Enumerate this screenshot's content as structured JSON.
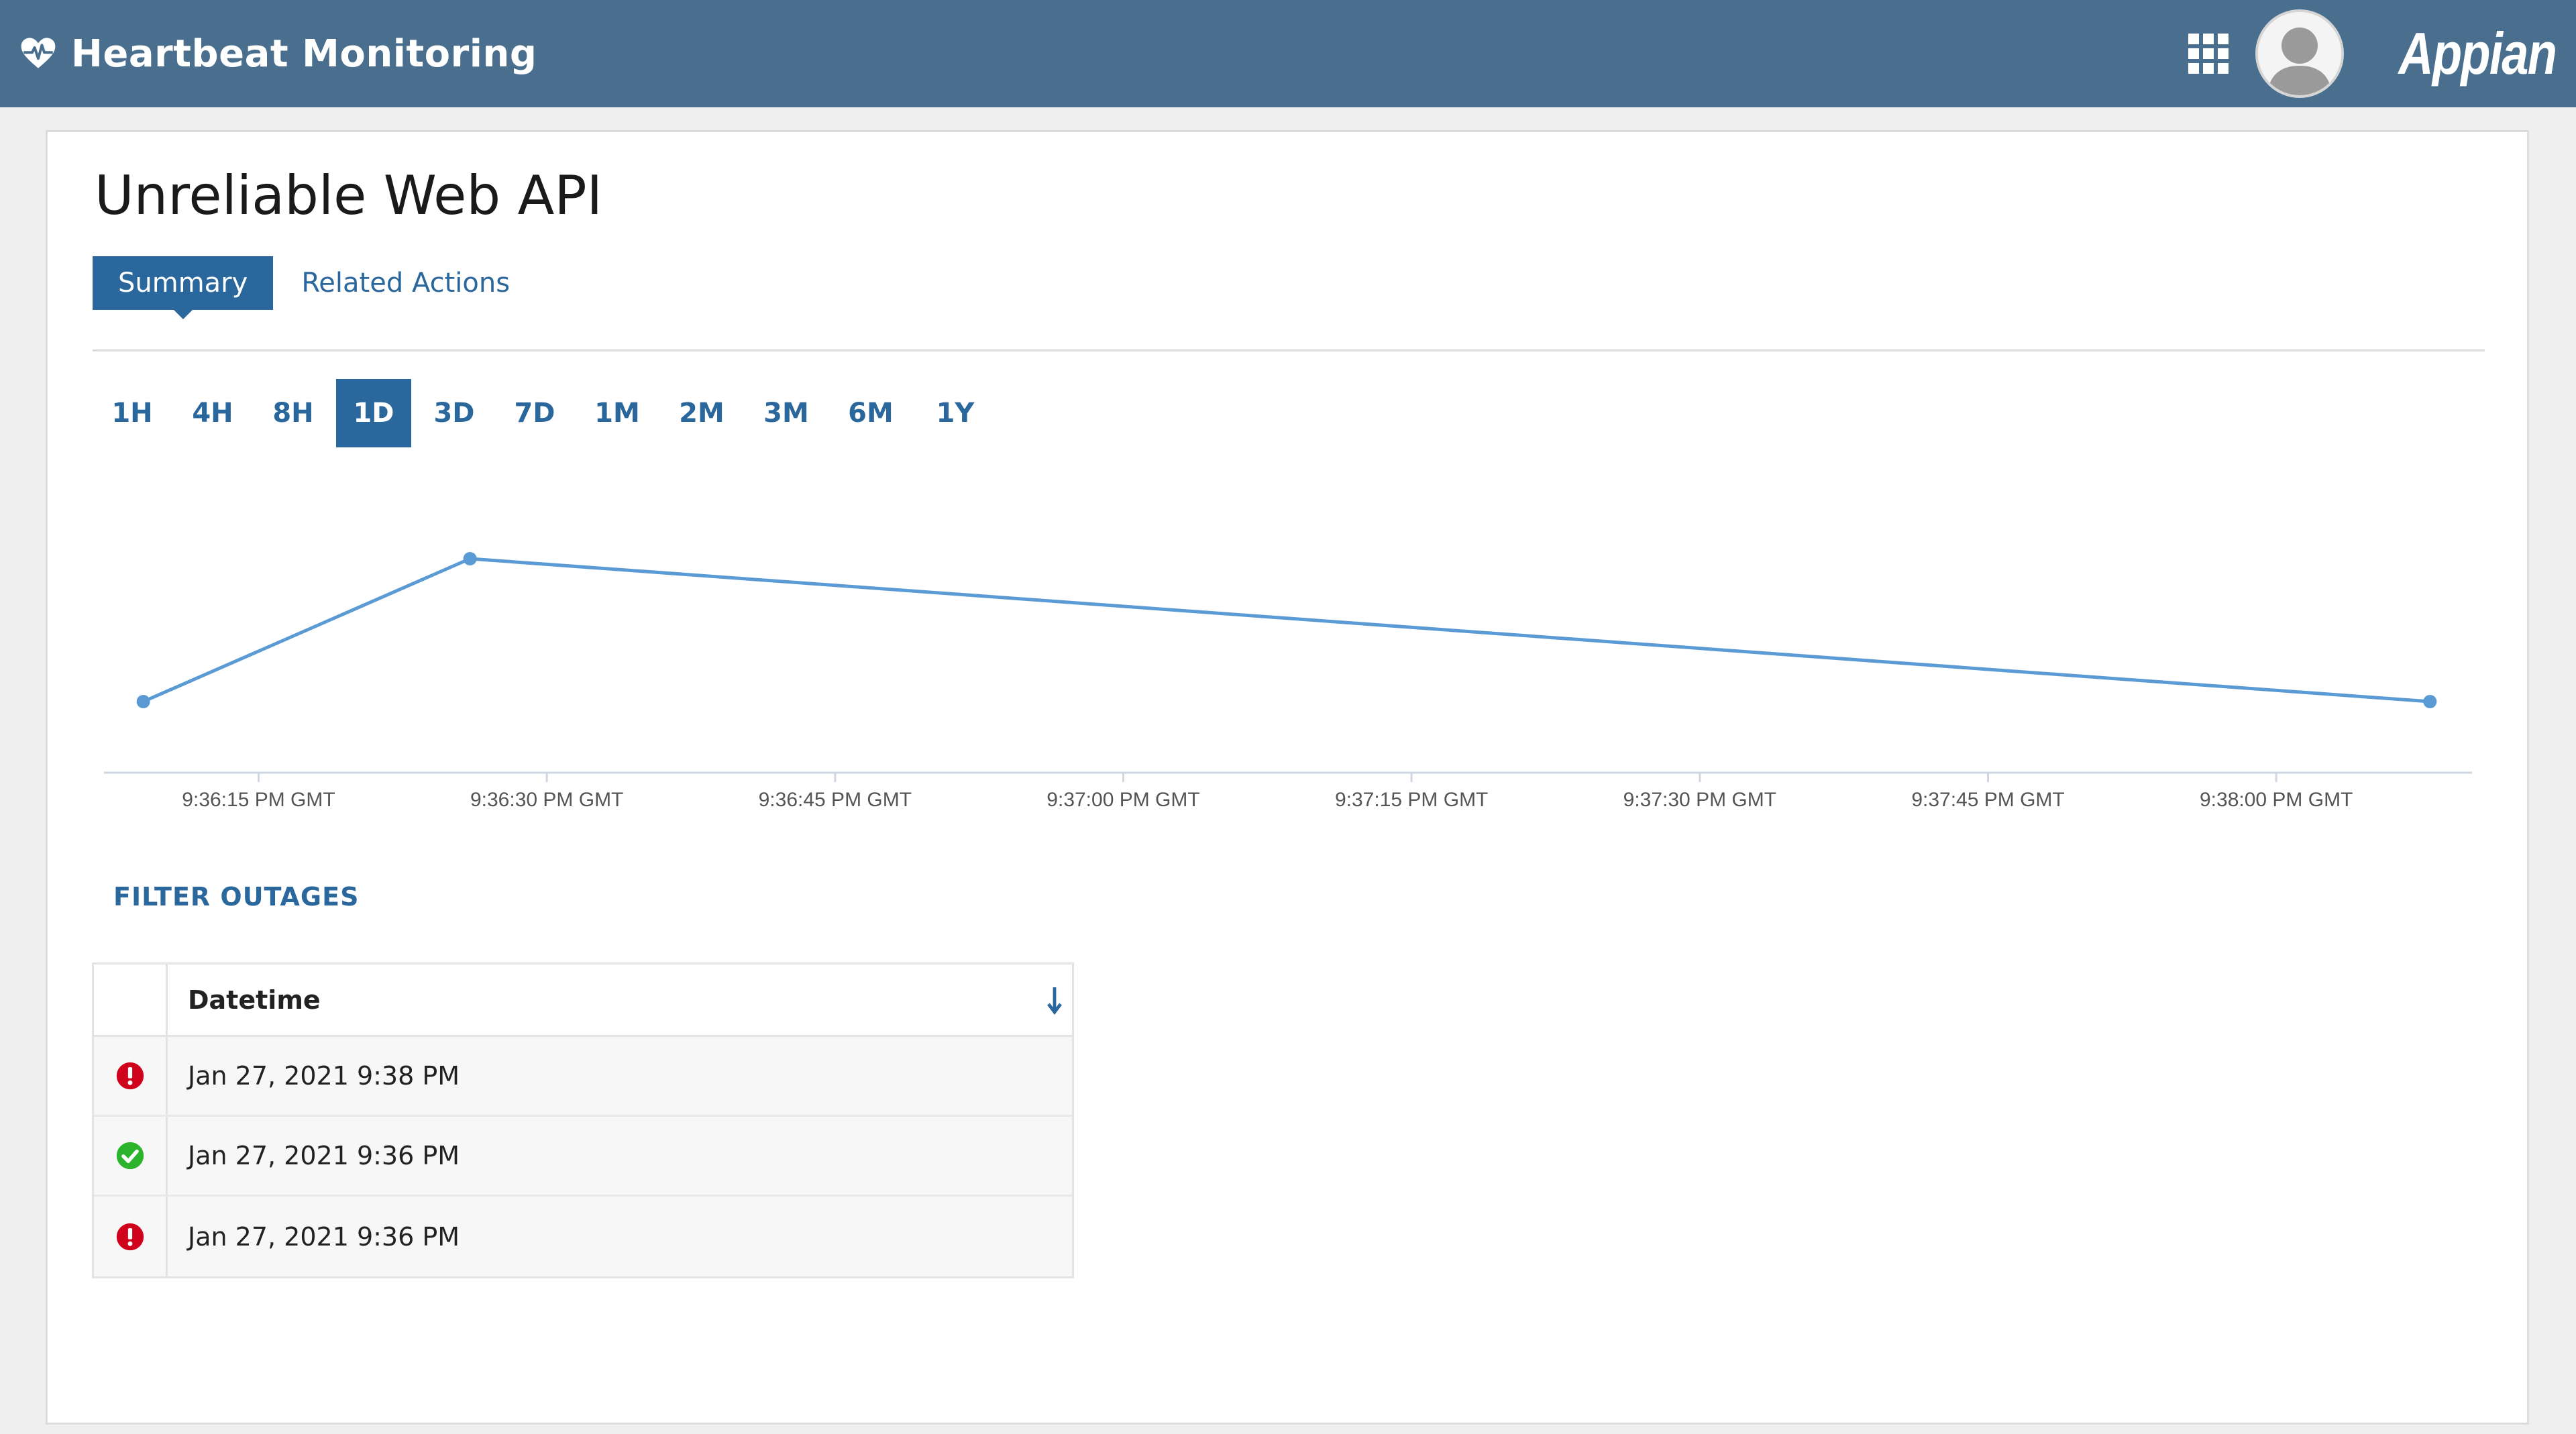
{
  "header": {
    "app_title": "Heartbeat Monitoring",
    "icons": {
      "app": "heart-pulse-icon",
      "launcher": "app-grid-icon",
      "avatar": "user-avatar"
    },
    "logo_text": "Appian",
    "bar_color": "#4a6f8e"
  },
  "record": {
    "title": "Unreliable Web API",
    "tabs": [
      {
        "label": "Summary",
        "active": true
      },
      {
        "label": "Related Actions",
        "active": false
      }
    ]
  },
  "ranges": {
    "options": [
      "1H",
      "4H",
      "8H",
      "1D",
      "3D",
      "7D",
      "1M",
      "2M",
      "3M",
      "6M",
      "1Y"
    ],
    "selected": "1D"
  },
  "chart_data": {
    "type": "line",
    "title": "",
    "xlabel": "",
    "ylabel": "",
    "x_ticks": [
      "9:36:15 PM GMT",
      "9:36:30 PM GMT",
      "9:36:45 PM GMT",
      "9:37:00 PM GMT",
      "9:37:15 PM GMT",
      "9:37:30 PM GMT",
      "9:37:45 PM GMT",
      "9:38:00 PM GMT"
    ],
    "series": [
      {
        "color": "#5b9bd5",
        "points": [
          {
            "x": "9:36:09 PM GMT",
            "y": 0
          },
          {
            "x": "9:36:26 PM GMT",
            "y": 1
          },
          {
            "x": "9:38:08 PM GMT",
            "y": 0
          }
        ]
      }
    ],
    "x_range": [
      "9:36:08 PM GMT",
      "9:38:09 PM GMT"
    ],
    "y_visible_axis": false,
    "grid": false
  },
  "outages": {
    "filter_label": "FILTER OUTAGES",
    "column_header": "Datetime",
    "sort_icon": "sort-descending-icon",
    "rows": [
      {
        "status": "error",
        "icon": "error-icon",
        "color": "#d0021b",
        "datetime": "Jan 27, 2021 9:38 PM"
      },
      {
        "status": "ok",
        "icon": "check-circle-icon",
        "color": "#2bb32b",
        "datetime": "Jan 27, 2021 9:36 PM"
      },
      {
        "status": "error",
        "icon": "error-icon",
        "color": "#d0021b",
        "datetime": "Jan 27, 2021 9:36 PM"
      }
    ]
  }
}
